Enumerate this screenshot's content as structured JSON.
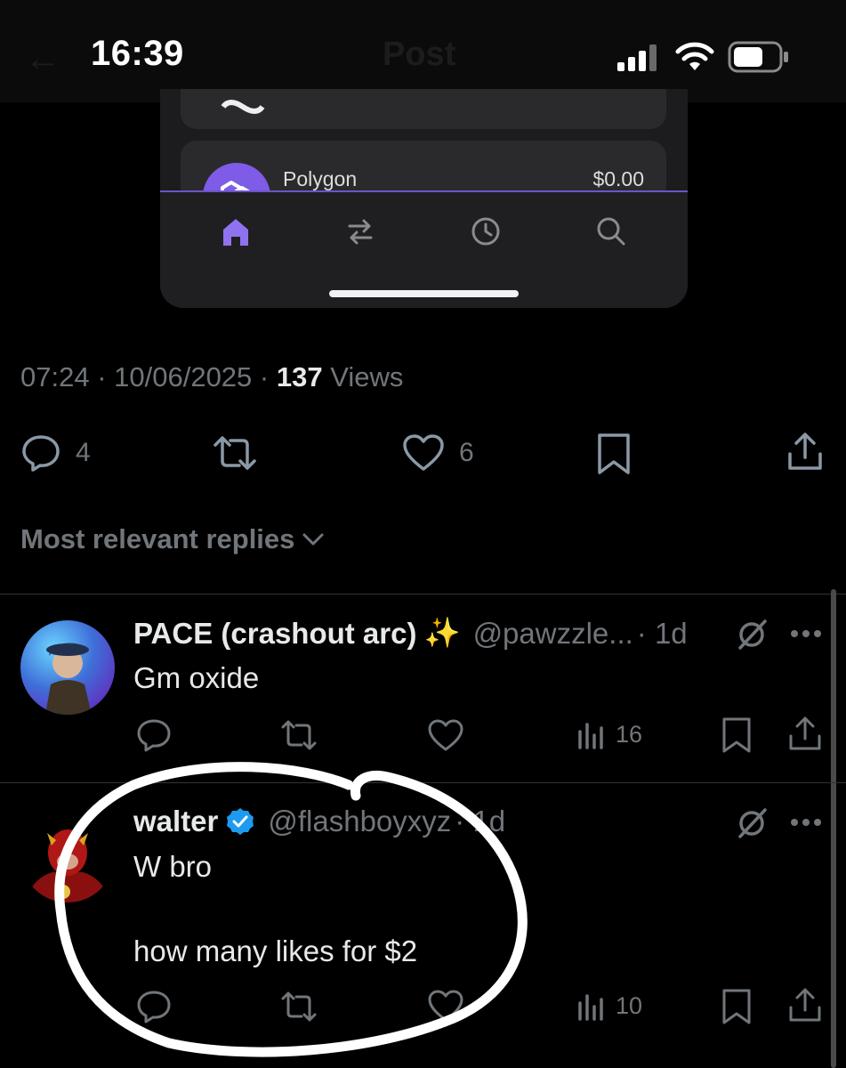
{
  "status_bar": {
    "time": "16:39"
  },
  "header": {
    "back_glyph": "←",
    "title": "Post"
  },
  "embed": {
    "token_name": "Polygon",
    "token_value": "$0.00",
    "tabs": [
      "home-icon",
      "swap-icon",
      "history-icon",
      "search-icon"
    ],
    "accent": "#7e5ce8"
  },
  "post": {
    "time": "07:24",
    "date": "10/06/2025",
    "views_count": "137",
    "views_label": "Views",
    "replies": "4",
    "likes": "6"
  },
  "replies_header": {
    "label": "Most relevant replies"
  },
  "replies": [
    {
      "name": "PACE (crashout arc)",
      "emoji": "✨",
      "handle": "@pawzzle...",
      "age": "· 1d",
      "text": "Gm oxide",
      "views": "16"
    },
    {
      "name": "walter",
      "handle": "@flashboyxyz",
      "age": "· 1d",
      "text_line1": "W bro",
      "text_line2": "how many likes for $2",
      "views": "10",
      "verified_color": "#1d9bf0"
    }
  ],
  "colors": {
    "muted": "#71767b",
    "text": "#e7e9ea",
    "background": "#000000"
  }
}
